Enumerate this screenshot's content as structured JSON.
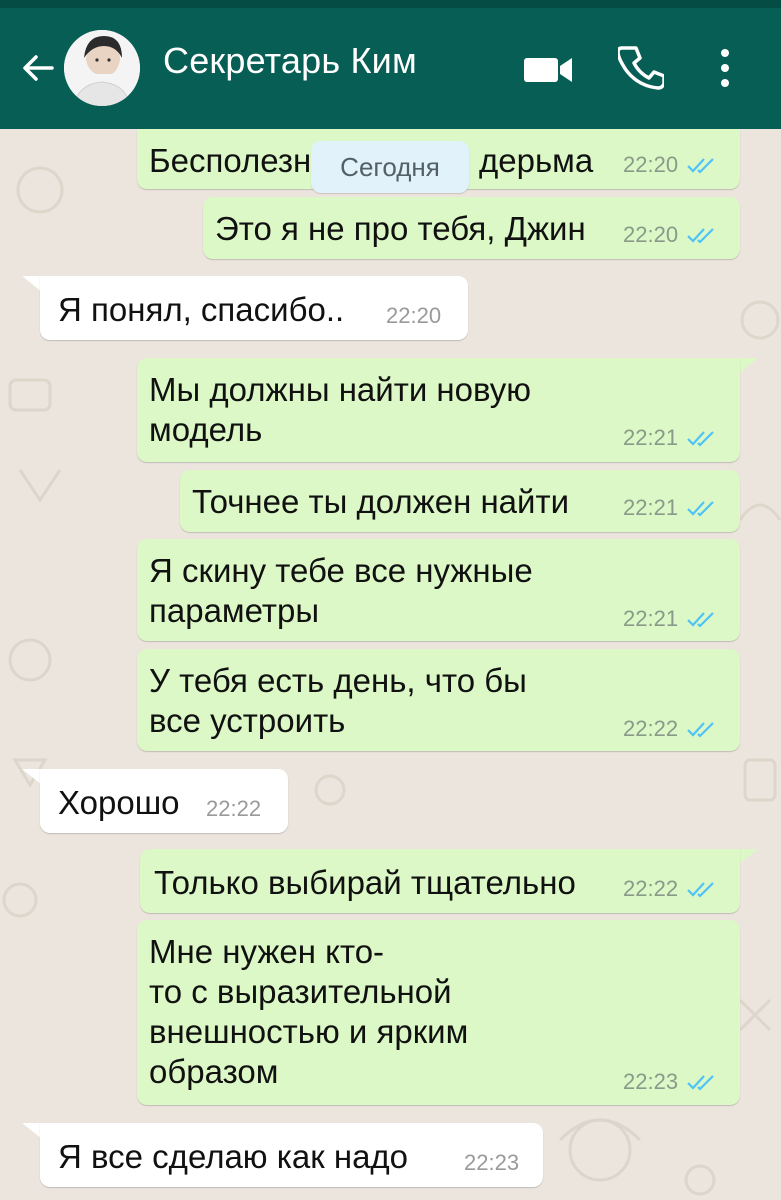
{
  "header": {
    "contact_name": "Секретарь Ким",
    "back_icon": "arrow-back-icon",
    "video_icon": "videocam-icon",
    "call_icon": "phone-icon",
    "menu_icon": "more-vert-icon",
    "bar_color": "#075e54"
  },
  "date_chip": "Сегодня",
  "messages": [
    {
      "dir": "out",
      "lines": [
        "Бесполезн",
        "дерьма"
      ],
      "time": "22:20",
      "ticks": "double-check-blue"
    },
    {
      "dir": "out",
      "lines": [
        "Это я не про тебя, Джин"
      ],
      "time": "22:20",
      "ticks": "double-check-blue"
    },
    {
      "dir": "in",
      "lines": [
        "Я понял, спасибо.."
      ],
      "time": "22:20"
    },
    {
      "dir": "out",
      "lines": [
        "Мы должны найти новую",
        "модель"
      ],
      "time": "22:21",
      "ticks": "double-check-blue"
    },
    {
      "dir": "out",
      "lines": [
        "Точнее ты должен найти"
      ],
      "time": "22:21",
      "ticks": "double-check-blue"
    },
    {
      "dir": "out",
      "lines": [
        "Я скину тебе все нужные",
        "параметры"
      ],
      "time": "22:21",
      "ticks": "double-check-blue"
    },
    {
      "dir": "out",
      "lines": [
        "У тебя есть день, что бы",
        "все устроить"
      ],
      "time": "22:22",
      "ticks": "double-check-blue"
    },
    {
      "dir": "in",
      "lines": [
        "Хорошо"
      ],
      "time": "22:22"
    },
    {
      "dir": "out",
      "lines": [
        "Только выбирай тщательно"
      ],
      "time": "22:22",
      "ticks": "double-check-blue"
    },
    {
      "dir": "out",
      "lines": [
        "Мне нужен кто-",
        "то с выразительной",
        "внешностью и ярким",
        "образом"
      ],
      "time": "22:23",
      "ticks": "double-check-blue"
    },
    {
      "dir": "in",
      "lines": [
        "Я все сделаю как надо"
      ],
      "time": "22:23"
    }
  ],
  "colors": {
    "outgoing_bubble": "#dcf8c6",
    "incoming_bubble": "#ffffff",
    "chat_background": "#ece5dd",
    "read_ticks": "#4fc3f7"
  }
}
